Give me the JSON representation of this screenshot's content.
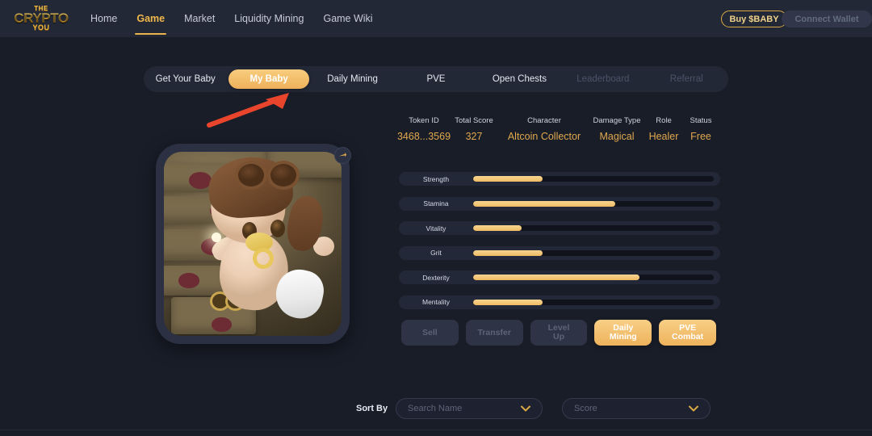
{
  "header": {
    "logo": {
      "line1": "THE",
      "line2": "CRYPTO",
      "line3": "YOU",
      "icon": "crown-icon"
    },
    "nav": [
      {
        "label": "Home",
        "active": false
      },
      {
        "label": "Game",
        "active": true
      },
      {
        "label": "Market",
        "active": false
      },
      {
        "label": "Liquidity Mining",
        "active": false
      },
      {
        "label": "Game Wiki",
        "active": false
      }
    ],
    "buy_button": "Buy $BABY",
    "connect_button": "Connect Wallet"
  },
  "tabs": [
    {
      "label": "Get Your Baby",
      "state": "normal"
    },
    {
      "label": "My Baby",
      "state": "active"
    },
    {
      "label": "Daily Mining",
      "state": "normal"
    },
    {
      "label": "PVE",
      "state": "normal"
    },
    {
      "label": "Open Chests",
      "state": "normal"
    },
    {
      "label": "Leaderboard",
      "state": "disabled"
    },
    {
      "label": "Referral",
      "state": "disabled"
    }
  ],
  "annotation": {
    "type": "arrow",
    "color": "#e8452c",
    "points_to": "My Baby"
  },
  "character_card": {
    "share_icon": "share-arrow-icon",
    "artwork_alt": "3D baby character with aviator cap and goggles"
  },
  "summary": [
    {
      "label": "Token ID",
      "value": "3468...3569"
    },
    {
      "label": "Total Score",
      "value": "327"
    },
    {
      "label": "Character",
      "value": "Altcoin Collector"
    },
    {
      "label": "Damage Type",
      "value": "Magical"
    },
    {
      "label": "Role",
      "value": "Healer"
    },
    {
      "label": "Status",
      "value": "Free"
    }
  ],
  "stats": [
    {
      "label": "Strength",
      "percent": 29
    },
    {
      "label": "Stamina",
      "percent": 59
    },
    {
      "label": "Vitality",
      "percent": 20
    },
    {
      "label": "Grit",
      "percent": 29
    },
    {
      "label": "Dexterity",
      "percent": 69
    },
    {
      "label": "Mentality",
      "percent": 29
    }
  ],
  "actions": [
    {
      "label": "Sell",
      "line2": "",
      "style": "dim"
    },
    {
      "label": "Transfer",
      "line2": "",
      "style": "dim"
    },
    {
      "label": "Level",
      "line2": "Up",
      "style": "dim"
    },
    {
      "label": "Daily",
      "line2": "Mining",
      "style": "gold"
    },
    {
      "label": "PVE",
      "line2": "Combat",
      "style": "gold"
    }
  ],
  "sort": {
    "label": "Sort By",
    "name_placeholder": "Search Name",
    "score_placeholder": "Score",
    "chevron_icon": "chevron-down-icon"
  },
  "colors": {
    "page_bg": "#191d28",
    "header_bg": "#232836",
    "accent_gold": "#e9b44c",
    "value_gold": "#e0a84e",
    "annotation_red": "#e8452c"
  }
}
